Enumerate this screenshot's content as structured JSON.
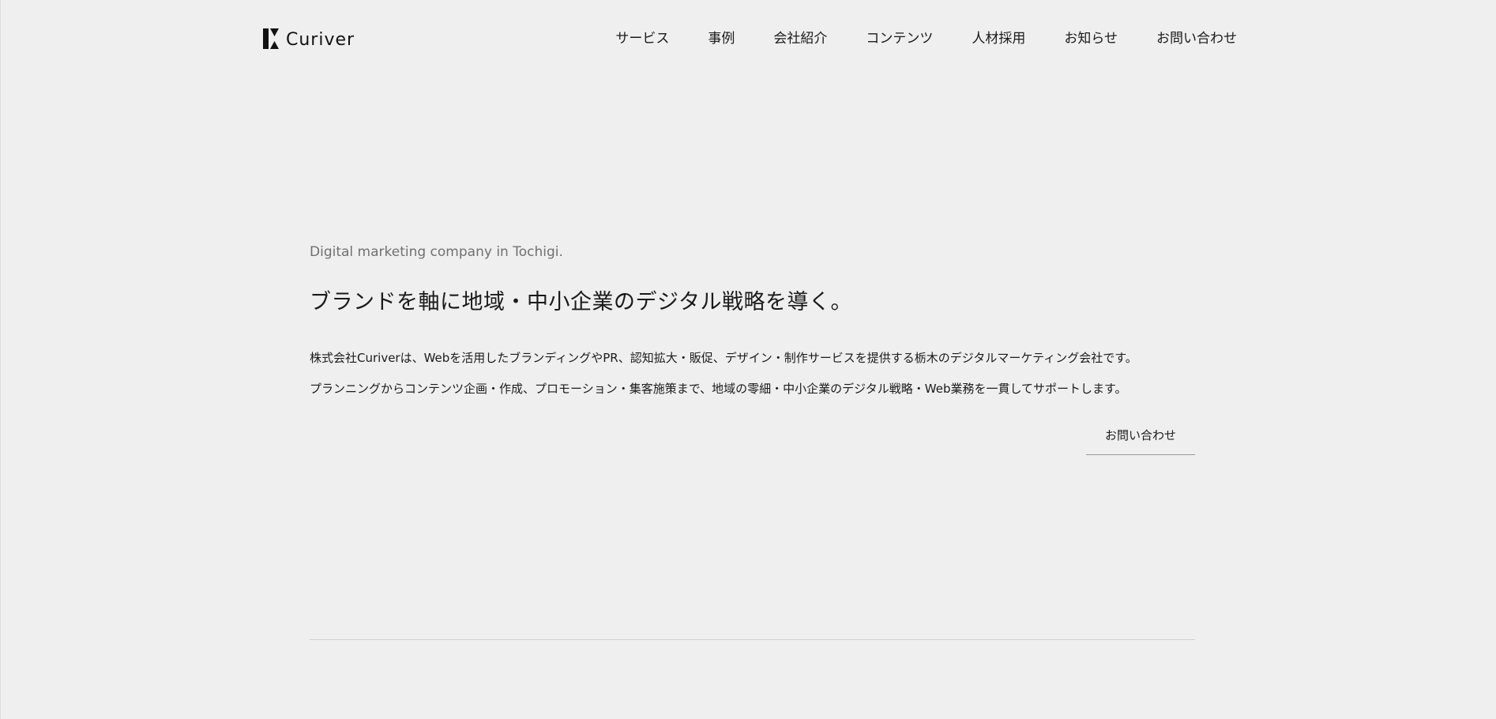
{
  "header": {
    "logo_text": "Curiver",
    "nav": [
      {
        "label": "サービス"
      },
      {
        "label": "事例"
      },
      {
        "label": "会社紹介"
      },
      {
        "label": "コンテンツ"
      },
      {
        "label": "人材採用"
      },
      {
        "label": "お知らせ"
      },
      {
        "label": "お問い合わせ"
      }
    ]
  },
  "hero": {
    "tagline_en": "Digital marketing company in Tochigi.",
    "headline": "ブランドを軸に地域・中小企業のデジタル戦略を導く。",
    "description": [
      "株式会社Curiverは、Webを活用したブランディングやPR、認知拡大・販促、デザイン・制作サービスを提供する栃木のデジタルマーケティング会社です。",
      "プランニングからコンテンツ企画・作成、プロモーション・集客施策まで、地域の零細・中小企業のデジタル戦略・Web業務を一貫してサポートします。"
    ],
    "cta_label": "お問い合わせ"
  },
  "colors": {
    "background": "#efefef",
    "text": "#1a1a1a",
    "tagline": "#707070",
    "divider": "#cfcfcf"
  },
  "icons": {
    "logo": "curiver-logo-mark"
  }
}
